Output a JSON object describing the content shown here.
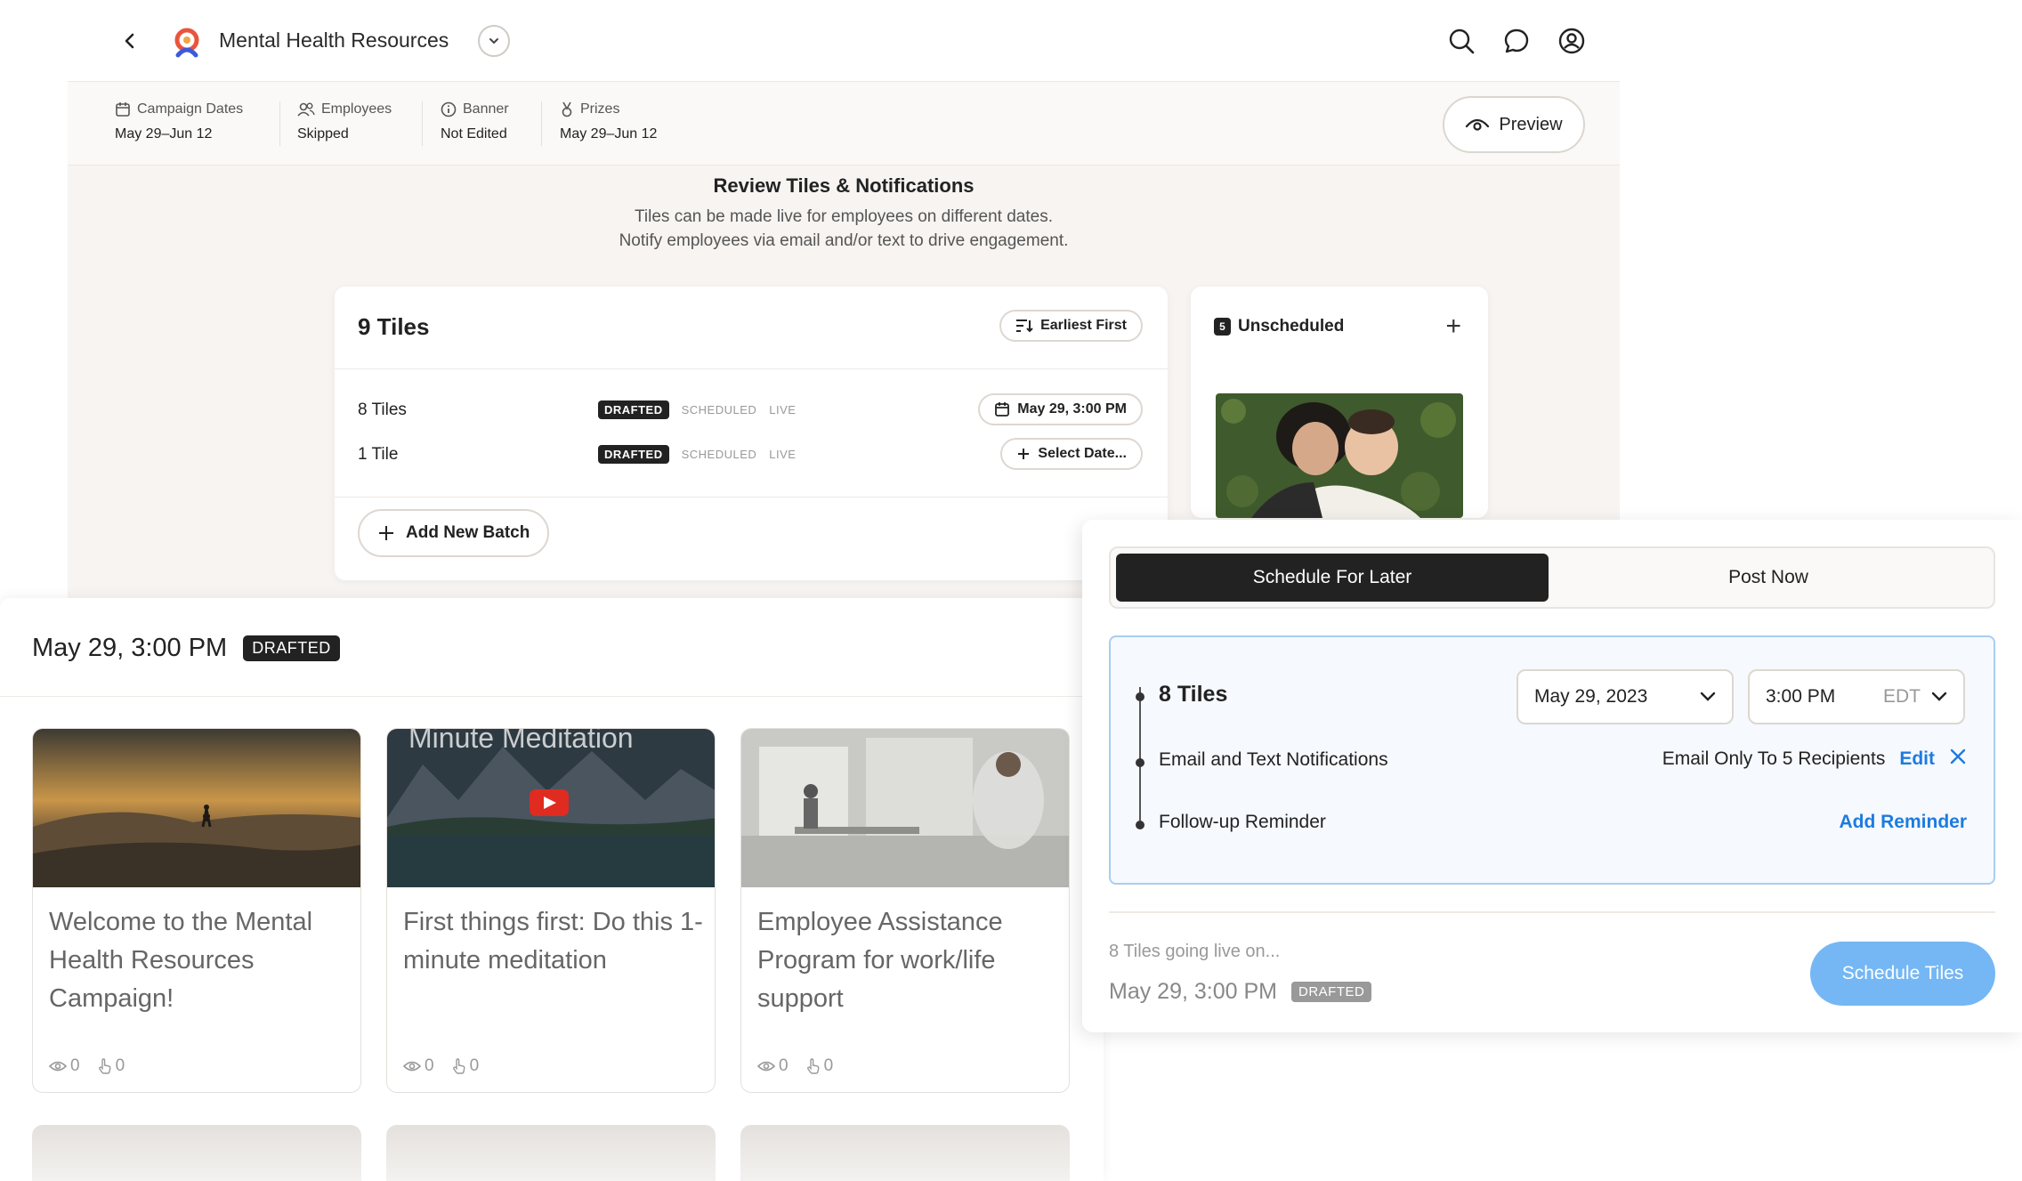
{
  "header": {
    "title": "Mental Health Resources",
    "icons": [
      "back-icon",
      "search-icon",
      "chat-icon",
      "account-icon"
    ]
  },
  "meta": [
    {
      "label": "Campaign Dates",
      "value": "May 29–Jun 12",
      "icon": "calendar-icon"
    },
    {
      "label": "Employees",
      "value": "Skipped",
      "icon": "users-icon"
    },
    {
      "label": "Banner",
      "value": "Not Edited",
      "icon": "info-icon"
    },
    {
      "label": "Prizes",
      "value": "May 29–Jun 12",
      "icon": "medal-icon"
    }
  ],
  "preview_label": "Preview",
  "review": {
    "title": "Review Tiles & Notifications",
    "line1": "Tiles can be made live for employees on different dates.",
    "line2": "Notify employees via email and/or text to drive engagement."
  },
  "tiles_card": {
    "title": "9 Tiles",
    "sort_label": "Earliest First",
    "batches": [
      {
        "name": "8 Tiles",
        "statuses": [
          "DRAFTED",
          "SCHEDULED",
          "LIVE"
        ],
        "date": "May 29, 3:00 PM"
      },
      {
        "name": "1 Tile",
        "statuses": [
          "DRAFTED",
          "SCHEDULED",
          "LIVE"
        ],
        "date": "Select Date..."
      }
    ],
    "add_batch": "Add New Batch"
  },
  "unscheduled": {
    "count": "5",
    "label": "Unscheduled"
  },
  "batch_panel": {
    "title": "May 29, 3:00 PM",
    "badge": "DRAFTED",
    "tiles": [
      {
        "title": "Welcome to the Mental Health Resources Campaign!",
        "views": "0",
        "clicks": "0"
      },
      {
        "title": "First things first: Do this 1-minute meditation",
        "views": "0",
        "clicks": "0",
        "overlay": "Minute Meditation"
      },
      {
        "title": "Employee Assistance Program for work/life support",
        "views": "0",
        "clicks": "0"
      }
    ]
  },
  "modal": {
    "tab_active": "Schedule For Later",
    "tab_inactive": "Post Now",
    "tiles_label": "8 Tiles",
    "date_value": "May 29, 2023",
    "time_value": "3:00 PM",
    "timezone": "EDT",
    "notifications_label": "Email and Text Notifications",
    "notifications_value": "Email Only To 5 Recipients",
    "edit_label": "Edit",
    "reminder_label": "Follow-up Reminder",
    "add_reminder": "Add Reminder",
    "going_live": "8 Tiles going live on...",
    "going_date": "May 29, 3:00 PM",
    "going_badge": "DRAFTED",
    "schedule_button": "Schedule Tiles"
  },
  "colors": {
    "accent": "#1d7be0",
    "schedule_button": "#74b7f4",
    "dark_pill": "#222222"
  }
}
